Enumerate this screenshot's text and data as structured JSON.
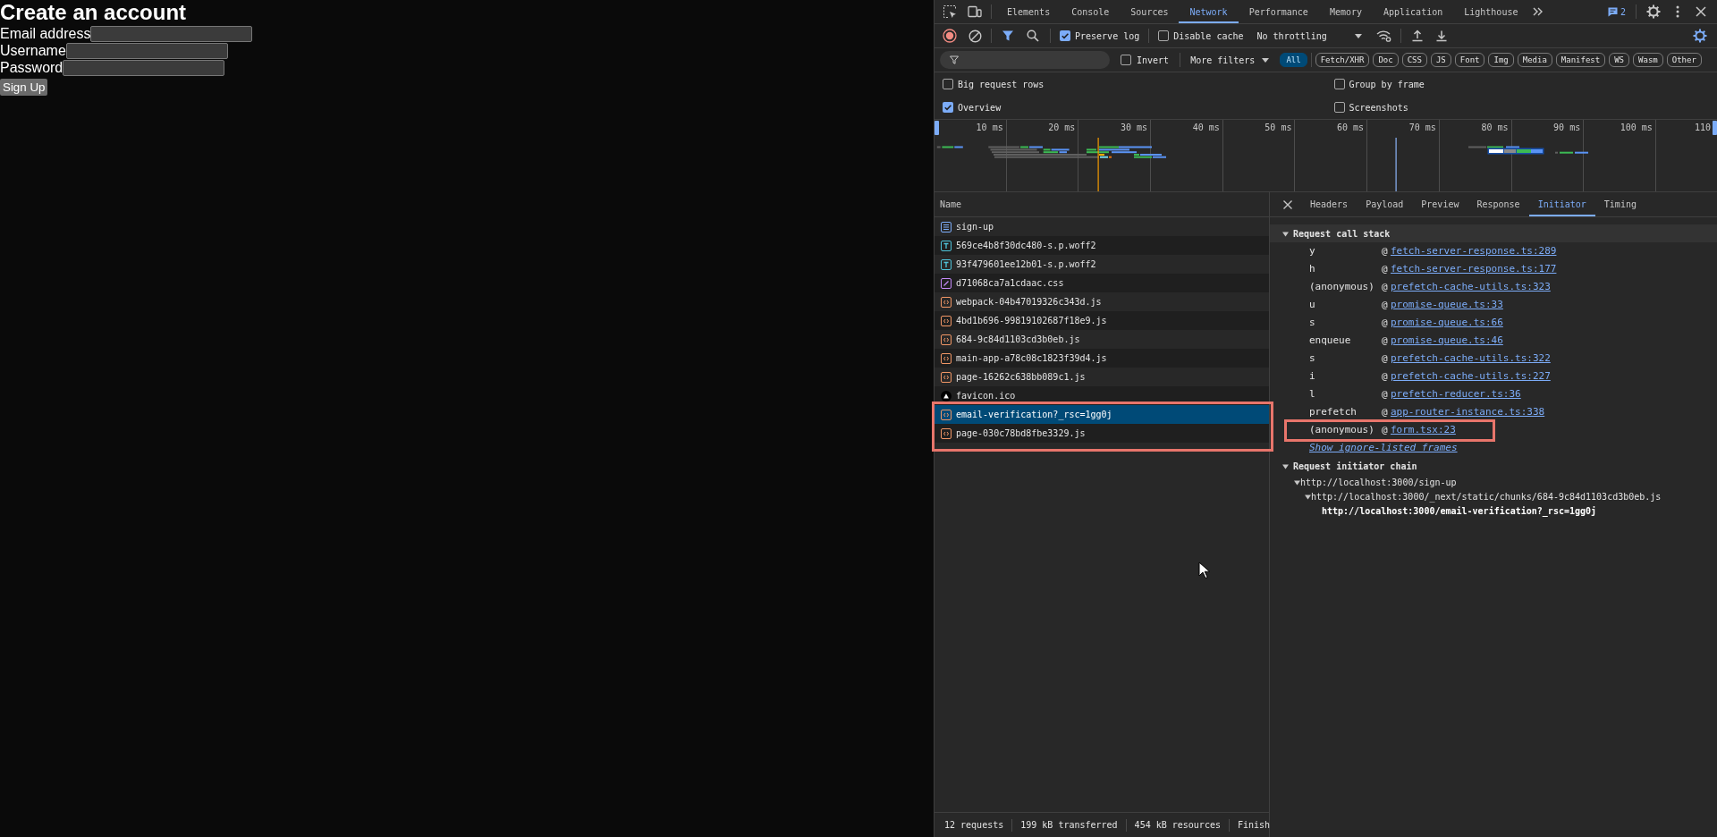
{
  "page": {
    "heading": "Create an account",
    "fields": [
      {
        "label": "Email address"
      },
      {
        "label": "Username"
      },
      {
        "label": "Password"
      }
    ],
    "submit": "Sign Up"
  },
  "devtools": {
    "tabs": [
      {
        "label": "Elements",
        "selected": false
      },
      {
        "label": "Console",
        "selected": false
      },
      {
        "label": "Sources",
        "selected": false
      },
      {
        "label": "Network",
        "selected": true
      },
      {
        "label": "Performance",
        "selected": false
      },
      {
        "label": "Memory",
        "selected": false
      },
      {
        "label": "Application",
        "selected": false
      },
      {
        "label": "Lighthouse",
        "selected": false
      }
    ],
    "issues_count": "2",
    "toolbar": {
      "recording": true,
      "options": [
        {
          "label": "Preserve log",
          "checked": true
        },
        {
          "label": "Disable cache",
          "checked": false
        }
      ],
      "throttling": "No throttling"
    },
    "filter": {
      "invert": {
        "label": "Invert",
        "checked": false
      },
      "more_filters": "More filters",
      "types": [
        {
          "label": "All",
          "selected": true
        },
        {
          "label": "Fetch/XHR",
          "selected": false
        },
        {
          "label": "Doc",
          "selected": false
        },
        {
          "label": "CSS",
          "selected": false
        },
        {
          "label": "JS",
          "selected": false
        },
        {
          "label": "Font",
          "selected": false
        },
        {
          "label": "Img",
          "selected": false
        },
        {
          "label": "Media",
          "selected": false
        },
        {
          "label": "Manifest",
          "selected": false
        },
        {
          "label": "WS",
          "selected": false
        },
        {
          "label": "Wasm",
          "selected": false
        },
        {
          "label": "Other",
          "selected": false
        }
      ]
    },
    "settings": [
      {
        "label": "Big request rows",
        "checked": false
      },
      {
        "label": "Group by frame",
        "checked": false
      },
      {
        "label": "Overview",
        "checked": true
      },
      {
        "label": "Screenshots",
        "checked": false
      }
    ],
    "overview": {
      "ticks": [
        "10 ms",
        "20 ms",
        "30 ms",
        "40 ms",
        "50 ms",
        "60 ms",
        "70 ms",
        "80 ms",
        "90 ms",
        "100 ms",
        "110"
      ]
    },
    "requests": {
      "column": "Name",
      "rows": [
        {
          "name": "sign-up",
          "kind": "document",
          "selected": false
        },
        {
          "name": "569ce4b8f30dc480-s.p.woff2",
          "kind": "font",
          "selected": false
        },
        {
          "name": "93f479601ee12b01-s.p.woff2",
          "kind": "font",
          "selected": false
        },
        {
          "name": "d71068ca7a1cdaac.css",
          "kind": "stylesheet",
          "selected": false
        },
        {
          "name": "webpack-04b47019326c343d.js",
          "kind": "script",
          "selected": false
        },
        {
          "name": "4bd1b696-99819102687f18e9.js",
          "kind": "script",
          "selected": false
        },
        {
          "name": "684-9c84d1103cd3b0eb.js",
          "kind": "script",
          "selected": false
        },
        {
          "name": "main-app-a78c08c1823f39d4.js",
          "kind": "script",
          "selected": false
        },
        {
          "name": "page-16262c638bb089c1.js",
          "kind": "script",
          "selected": false
        },
        {
          "name": "favicon.ico",
          "kind": "image",
          "selected": false
        },
        {
          "name": "email-verification?_rsc=1gg0j",
          "kind": "script",
          "selected": true
        },
        {
          "name": "page-030c78bd8fbe3329.js",
          "kind": "script",
          "selected": false
        }
      ]
    },
    "details": {
      "tabs": [
        {
          "label": "Headers",
          "selected": false
        },
        {
          "label": "Payload",
          "selected": false
        },
        {
          "label": "Preview",
          "selected": false
        },
        {
          "label": "Response",
          "selected": false
        },
        {
          "label": "Initiator",
          "selected": true
        },
        {
          "label": "Timing",
          "selected": false
        }
      ],
      "call_stack": {
        "title": "Request call stack",
        "expanded": true,
        "frames": [
          {
            "function": "y",
            "at": "@",
            "location": "fetch-server-response.ts:289"
          },
          {
            "function": "h",
            "at": "@",
            "location": "fetch-server-response.ts:177"
          },
          {
            "function": "(anonymous)",
            "at": "@",
            "location": "prefetch-cache-utils.ts:323"
          },
          {
            "function": "u",
            "at": "@",
            "location": "promise-queue.ts:33"
          },
          {
            "function": "s",
            "at": "@",
            "location": "promise-queue.ts:66"
          },
          {
            "function": "enqueue",
            "at": "@",
            "location": "promise-queue.ts:46"
          },
          {
            "function": "s",
            "at": "@",
            "location": "prefetch-cache-utils.ts:322"
          },
          {
            "function": "i",
            "at": "@",
            "location": "prefetch-cache-utils.ts:227"
          },
          {
            "function": "l",
            "at": "@",
            "location": "prefetch-reducer.ts:36"
          },
          {
            "function": "prefetch",
            "at": "@",
            "location": "app-router-instance.ts:338"
          },
          {
            "function": "(anonymous)",
            "at": "@",
            "location": "form.tsx:23"
          }
        ],
        "more_link": "Show ignore-listed frames"
      },
      "initiator_chain": {
        "title": "Request initiator chain",
        "expanded": true,
        "items": [
          {
            "url": "http://localhost:3000/sign-up",
            "expanded": true,
            "current": false,
            "children": [
              {
                "url": "http://localhost:3000/_next/static/chunks/684-9c84d1103cd3b0eb.js",
                "expanded": true,
                "current": false,
                "children": [
                  {
                    "url": "http://localhost:3000/email-verification?_rsc=1gg0j",
                    "current": true
                  }
                ]
              }
            ]
          }
        ]
      }
    },
    "status_bar": [
      "12 requests",
      "199 kB transferred",
      "454 kB resources",
      "Finish"
    ]
  }
}
